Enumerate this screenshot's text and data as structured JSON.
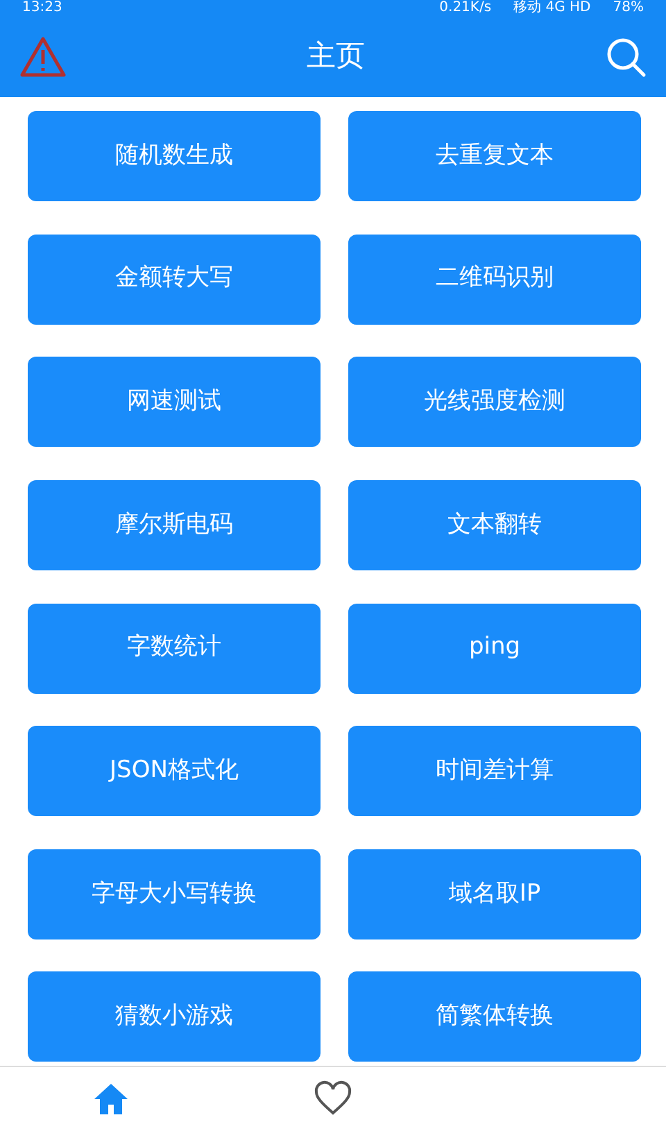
{
  "status_bar": {
    "time": "13:23",
    "speed": "0.21K/s",
    "network": "移动 4G HD",
    "battery": "78%"
  },
  "header": {
    "title": "主页"
  },
  "tools": [
    {
      "label": "随机数生成"
    },
    {
      "label": "去重复文本"
    },
    {
      "label": "金额转大写"
    },
    {
      "label": "二维码识别"
    },
    {
      "label": "网速测试"
    },
    {
      "label": "光线强度检测"
    },
    {
      "label": "摩尔斯电码"
    },
    {
      "label": "文本翻转"
    },
    {
      "label": "字数统计"
    },
    {
      "label": "ping"
    },
    {
      "label": "JSON格式化"
    },
    {
      "label": "时间差计算"
    },
    {
      "label": "字母大小写转换"
    },
    {
      "label": "域名取IP"
    },
    {
      "label": "猜数小游戏"
    },
    {
      "label": "简繁体转换"
    }
  ],
  "bottom_nav": [
    {
      "kind": "home",
      "selected": true
    },
    {
      "kind": "favorites",
      "selected": false
    }
  ]
}
